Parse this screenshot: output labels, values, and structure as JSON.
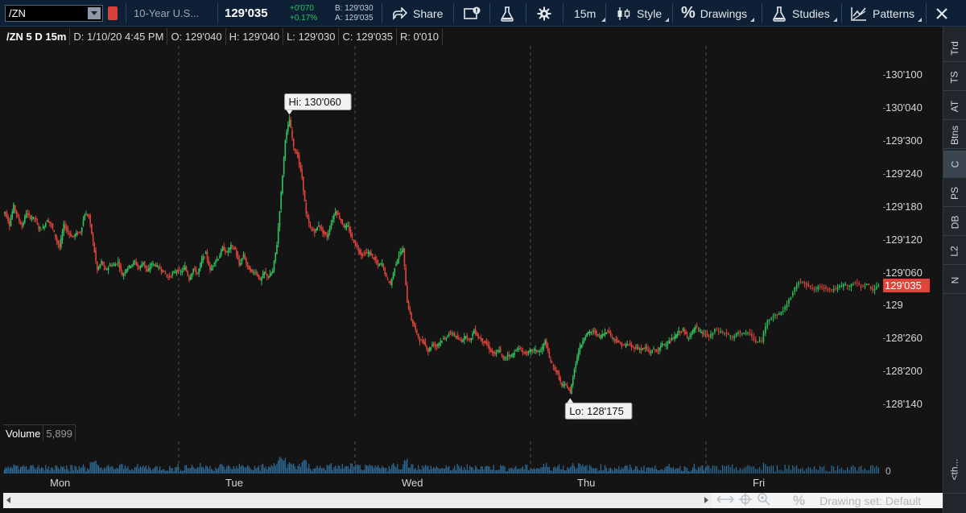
{
  "toolbar": {
    "symbol": "/ZN",
    "description": "10-Year U.S...",
    "last_price": "129'035",
    "net_change": "+0'070",
    "pct_change": "+0.17%",
    "bid": "B: 129'030",
    "ask": "A: 129'035",
    "share_label": "Share",
    "timeframe_label": "15m",
    "style_label": "Style",
    "drawings_label": "Drawings",
    "studies_label": "Studies",
    "patterns_label": "Patterns",
    "pct_glyph": "%",
    "up_color": "#2fc35f",
    "down_color": "#e2443c"
  },
  "infobar": {
    "title": "/ZN 5 D 15m",
    "date": "D: 1/10/20 4:45 PM",
    "open": "O: 129'040",
    "high": "H: 129'040",
    "low": "L: 129'030",
    "close": "C: 129'035",
    "range": "R: 0'010"
  },
  "annotations": {
    "hi": "Hi: 130'060",
    "lo": "Lo: 128'175",
    "last": "129'035"
  },
  "volume": {
    "label": "Volume",
    "value": "5,899",
    "axis_zero": "0"
  },
  "side_tabs": [
    "Trd",
    "TS",
    "AT",
    "Btns",
    "C",
    "PS",
    "DB",
    "L2",
    "N",
    "<th..."
  ],
  "bottom": {
    "drawing_set": "Drawing set: Default"
  },
  "chart_data": {
    "type": "candlestick",
    "price_ticks": [
      "130'100",
      "130'040",
      "129'300",
      "129'240",
      "129'180",
      "129'120",
      "129'060",
      "129",
      "128'260",
      "128'200",
      "128'140"
    ],
    "price_tick_values": [
      130.3125,
      130.125,
      129.9375,
      129.75,
      129.5625,
      129.375,
      129.1875,
      129.0,
      128.8125,
      128.625,
      128.4375
    ],
    "ylim": [
      128.35,
      130.48
    ],
    "time_ticks": [
      "Mon",
      "Tue",
      "Wed",
      "Thu",
      "Fri"
    ],
    "series": [
      {
        "day": "Mon",
        "points": [
          129.53,
          129.46,
          129.57,
          129.5,
          129.45,
          129.53,
          129.5,
          129.5,
          129.44,
          129.44,
          129.49,
          129.46,
          129.39,
          129.33,
          129.46,
          129.42,
          129.39,
          129.41,
          129.42,
          129.52,
          129.51,
          129.36,
          129.2,
          129.25,
          129.2,
          129.23,
          129.23,
          129.25,
          129.17,
          129.21,
          129.23,
          129.25,
          129.21,
          129.25,
          129.19,
          129.24,
          129.23,
          129.21,
          129.19,
          129.16,
          129.18,
          129.2
        ]
      },
      {
        "day": "Tue",
        "points": [
          129.19,
          129.22,
          129.15,
          129.21,
          129.18,
          129.26,
          129.3,
          129.2,
          129.25,
          129.27,
          129.33,
          129.3,
          129.34,
          129.32,
          129.23,
          129.29,
          129.22,
          129.19,
          129.19,
          129.14,
          129.19,
          129.16,
          129.2,
          129.35,
          129.64,
          129.95,
          130.06,
          129.9,
          129.85,
          129.73,
          129.52,
          129.44,
          129.42,
          129.46,
          129.42,
          129.39,
          129.47,
          129.54,
          129.5,
          129.45,
          129.45,
          129.38
        ]
      },
      {
        "day": "Wed",
        "points": [
          129.33,
          129.29,
          129.3,
          129.3,
          129.27,
          129.23,
          129.24,
          129.16,
          129.12,
          129.22,
          129.29,
          129.32,
          129.02,
          128.92,
          128.86,
          128.8,
          128.79,
          128.74,
          128.78,
          128.77,
          128.8,
          128.81,
          128.84,
          128.84,
          128.81,
          128.8,
          128.83,
          128.8,
          128.86,
          128.82,
          128.8,
          128.78,
          128.74,
          128.72,
          128.75,
          128.69,
          128.72,
          128.71,
          128.75,
          128.75,
          128.73,
          128.73
        ]
      },
      {
        "day": "Thu",
        "points": [
          128.75,
          128.74,
          128.74,
          128.8,
          128.7,
          128.65,
          128.61,
          128.54,
          128.55,
          128.5,
          128.64,
          128.74,
          128.8,
          128.84,
          128.85,
          128.85,
          128.82,
          128.84,
          128.86,
          128.82,
          128.8,
          128.78,
          128.77,
          128.78,
          128.76,
          128.76,
          128.75,
          128.76,
          128.73,
          128.75,
          128.74,
          128.78,
          128.78,
          128.8,
          128.82,
          128.85,
          128.86,
          128.82,
          128.84,
          128.88,
          128.85,
          128.84
        ]
      },
      {
        "day": "Fri",
        "points": [
          128.82,
          128.86,
          128.85,
          128.84,
          128.81,
          128.85,
          128.84,
          128.84,
          128.79,
          128.8,
          128.92,
          128.94,
          128.95,
          128.99,
          129.05,
          129.12,
          129.14,
          129.11,
          129.09,
          129.11,
          129.1,
          129.09,
          129.1,
          129.12,
          129.11,
          129.13,
          129.11,
          129.12,
          129.09,
          129.11
        ]
      }
    ]
  }
}
